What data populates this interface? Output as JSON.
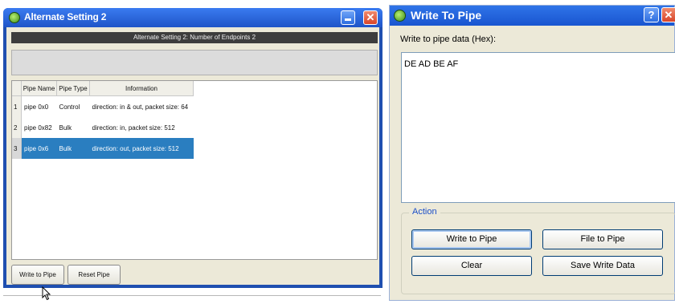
{
  "left_window": {
    "title": "Alternate Setting 2",
    "header": "Alternate Setting 2: Number of Endpoints 2",
    "table": {
      "columns": [
        "Pipe Name",
        "Pipe Type",
        "Information"
      ],
      "rows": [
        {
          "num": "1",
          "name": "pipe 0x0",
          "type": "Control",
          "info": "direction: in & out, packet size: 64"
        },
        {
          "num": "2",
          "name": "pipe 0x82",
          "type": "Bulk",
          "info": "direction: in, packet size: 512"
        },
        {
          "num": "3",
          "name": "pipe 0x6",
          "type": "Bulk",
          "info": "direction: out, packet size: 512"
        }
      ]
    },
    "buttons": {
      "write": "Write to Pipe",
      "reset": "Reset Pipe"
    },
    "close_glyph": "✕"
  },
  "right_window": {
    "title": "Write To Pipe",
    "help_glyph": "?",
    "close_glyph": "✕",
    "data_label": "Write to pipe data (Hex):",
    "data_value": "DE AD BE AF",
    "action_group": "Action",
    "buttons": {
      "write": "Write to Pipe",
      "file": "File to Pipe",
      "clear": "Clear",
      "save": "Save Write Data"
    }
  },
  "colors": {
    "titlebar": "#1f55c8",
    "selection": "#2a7ec0",
    "window_bg": "#ece9d8",
    "close_button": "#d8452a"
  }
}
